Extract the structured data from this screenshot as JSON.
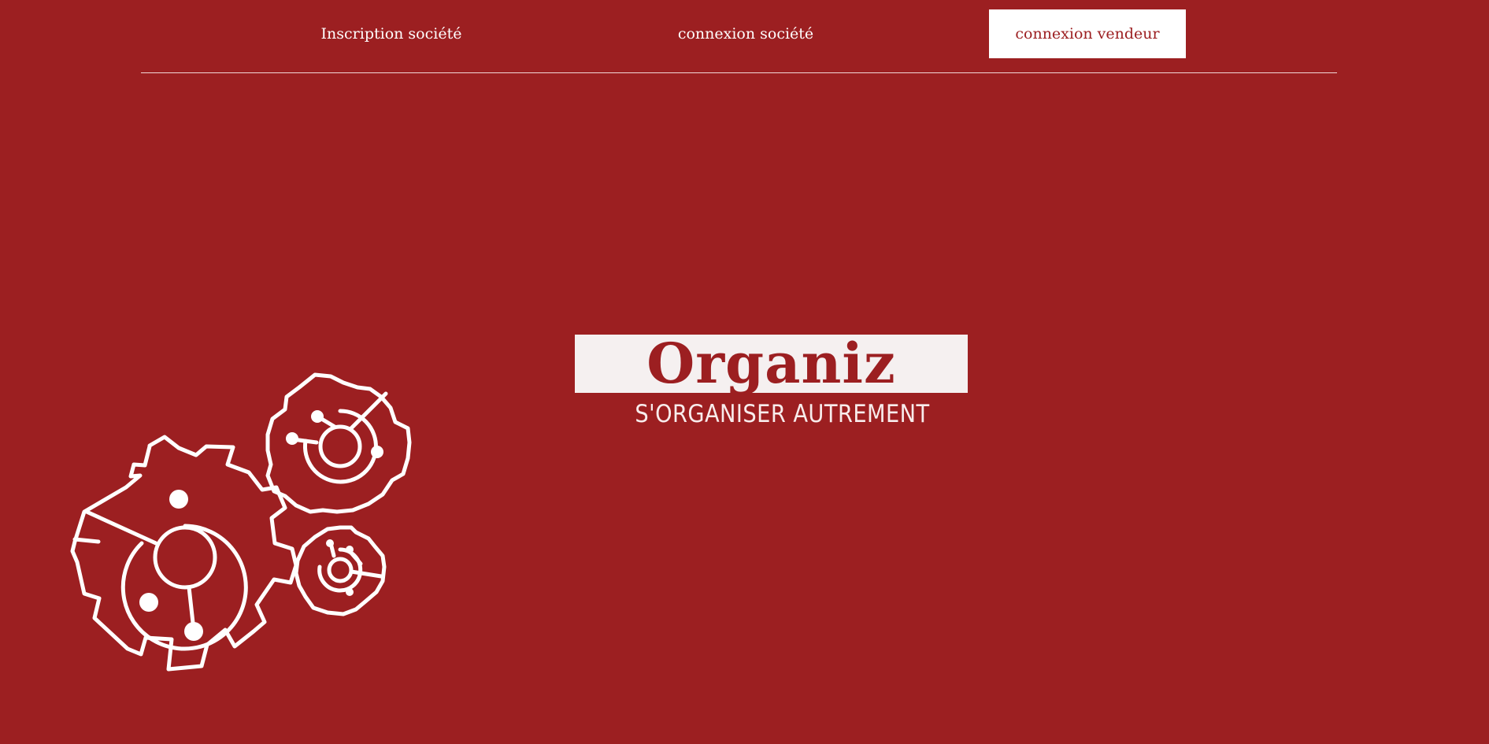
{
  "nav": {
    "items": [
      {
        "label": "Inscription société"
      },
      {
        "label": "connexion société"
      },
      {
        "label": "connexion vendeur"
      }
    ]
  },
  "logo": {
    "title": "Organiz",
    "tagline": "S'ORGANISER AUTREMENT"
  },
  "icons": {
    "gears": "gears-icon"
  },
  "colors": {
    "background": "#9c1f21",
    "accent": "#ffffff",
    "logo_box": "#f5f0f0"
  }
}
